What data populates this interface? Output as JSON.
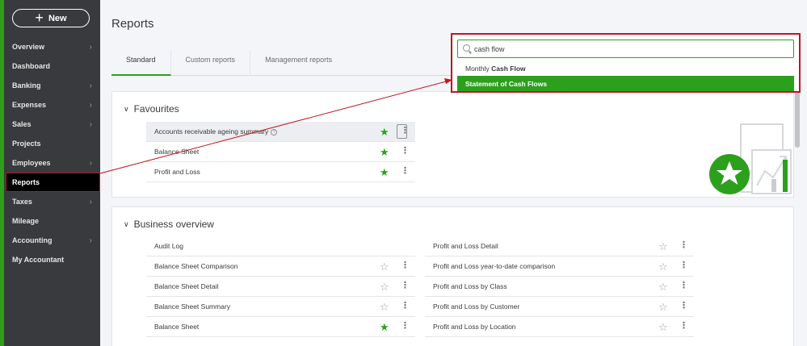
{
  "sidebar": {
    "new_label": "New",
    "items": [
      {
        "label": "Overview",
        "chevron": true
      },
      {
        "label": "Dashboard",
        "chevron": false
      },
      {
        "label": "Banking",
        "chevron": true
      },
      {
        "label": "Expenses",
        "chevron": true
      },
      {
        "label": "Sales",
        "chevron": true
      },
      {
        "label": "Projects",
        "chevron": false
      },
      {
        "label": "Employees",
        "chevron": true
      },
      {
        "label": "Reports",
        "chevron": false,
        "active": true
      },
      {
        "label": "Taxes",
        "chevron": true
      },
      {
        "label": "Mileage",
        "chevron": false
      },
      {
        "label": "Accounting",
        "chevron": true
      },
      {
        "label": "My Accountant",
        "chevron": false
      }
    ]
  },
  "page": {
    "title": "Reports"
  },
  "tabs": [
    "Standard",
    "Custom reports",
    "Management reports"
  ],
  "search": {
    "value": "cash flow",
    "results": [
      {
        "prefix": "Monthly ",
        "match": "Cash Flow"
      },
      {
        "label": "Statement of Cash Flows",
        "selected": true
      }
    ]
  },
  "favourites": {
    "title": "Favourites",
    "rows": [
      "Accounts receivable ageing summary",
      "Balance Sheet",
      "Profit and Loss"
    ]
  },
  "business": {
    "title": "Business overview",
    "left": [
      {
        "label": "Audit Log",
        "star": "none"
      },
      {
        "label": "Balance Sheet Comparison",
        "star": "empty"
      },
      {
        "label": "Balance Sheet Detail",
        "star": "empty"
      },
      {
        "label": "Balance Sheet Summary",
        "star": "empty"
      },
      {
        "label": "Balance Sheet",
        "star": "filled"
      }
    ],
    "right": [
      {
        "label": "Profit and Loss Detail",
        "star": "empty"
      },
      {
        "label": "Profit and Loss year-to-date comparison",
        "star": "empty"
      },
      {
        "label": "Profit and Loss by Class",
        "star": "empty"
      },
      {
        "label": "Profit and Loss by Customer",
        "star": "empty"
      },
      {
        "label": "Profit and Loss by Location",
        "star": "empty"
      }
    ]
  },
  "colors": {
    "accent": "#2ca01c",
    "sidebar": "#393a3d",
    "highlight": "#c0161e"
  }
}
